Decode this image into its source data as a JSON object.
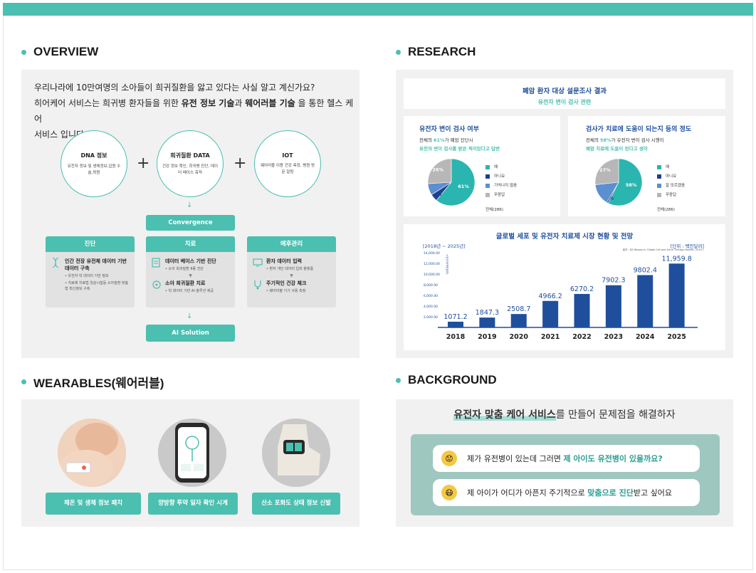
{
  "sections": {
    "overview": "OVERVIEW",
    "research": "RESEARCH",
    "wearables": "WEARABLES(웨어러블)",
    "background": "BACKGROUND"
  },
  "overview": {
    "line1": "우리나라에 10만여명의 소아들이 희귀질환을 앓고 있다는 사실 알고 계신가요?",
    "line2_a": "히어케어 서비스는 희귀병 환자들을 위한 ",
    "line2_b": "유전 정보 기술",
    "line2_c": "과 ",
    "line2_d": "웨어러블 기술",
    "line2_e": " 을 통한 헬스 케어",
    "line3": "서비스 입니다 .",
    "circles": [
      {
        "title": "DNA 정보",
        "desc": "유전자 정보 및 생체정보,입원 수술,퇴원"
      },
      {
        "title": "희귀질환 DATA",
        "desc": "건강 정보 확인, 희귀병 진단, 데이터 베이스 축적"
      },
      {
        "title": "IOT",
        "desc": "웨어러블 이용 건강 측정, 병원 방문 알림"
      }
    ],
    "plus": "+",
    "arrow": "↓",
    "convergence": "Convergence",
    "ai": "AI Solution",
    "cards": [
      {
        "header": "진단",
        "items": [
          {
            "icon": "dna-icon",
            "title": "인간 전장 유전체 데이터 기반 데이터 구축",
            "desc1": "• 유전자 빅 데이터 기반 정보",
            "desc2": "• 치료제 치료법 임상시험등 소아질환 맞춤형 최신정보 구축"
          }
        ]
      },
      {
        "header": "치료",
        "items": [
          {
            "icon": "document-icon",
            "title": "데이터 베이스 기반 진단",
            "desc1": "• 소아 희귀질환 8종 진단",
            "desc2": ""
          },
          {
            "icon": "ai-brain-icon",
            "title": "소아 희귀질환 치료",
            "desc1": "• 빅 데이터 기반 AI 솔루션 제공",
            "desc2": ""
          }
        ]
      },
      {
        "header": "예후관리",
        "items": [
          {
            "icon": "monitor-icon",
            "title": "환자 데이터 입력",
            "desc1": "• 환자 개인 데이터 입력 플랫폼",
            "desc2": ""
          },
          {
            "icon": "stethoscope-icon",
            "title": "주기적인 건강 체크",
            "desc1": "• 웨어러블 기기 사용 측정",
            "desc2": ""
          }
        ]
      }
    ],
    "mini_arrow": "▼"
  },
  "research": {
    "survey_title": "폐암 환자 대상 설문조사 결과",
    "survey_sub": "유전자 변이 검사 관련",
    "pie1": {
      "title": "유전자 변이 검사 여부",
      "sub1_a": "전체의 ",
      "sub1_b": "61%",
      "sub1_c": "가 폐암 진단시",
      "sub2": "유전자 변이 검사를 받은 적이있다고 답변",
      "footer": "전체(286)"
    },
    "pie2": {
      "title": "검사가 치료에 도움이 되는지 등의 정도",
      "sub1_a": "전체의 ",
      "sub1_b": "58%",
      "sub1_c": "가 유전자 변이 검사 시행이",
      "sub2": "폐암 치료에 도움이 된다고 생각",
      "footer": "전체(286)"
    },
    "bar": {
      "title": "글로벌 세포 및 유전자 치료제 시장 현황 및 전망",
      "period": "[2018년 ~ 2025년]",
      "unit": "[단위 : 백만달러]",
      "source": "출처 : DS Research, Global Cell and Gene Therapy Market, 2019.7",
      "yticks": [
        "14,000.00",
        "12,000.00",
        "10,000.00",
        "8,000.00",
        "6,000.00",
        "4,000.00",
        "2,000.00"
      ],
      "ylabel": "시장규모(백만달러)"
    }
  },
  "chart_data": [
    {
      "type": "pie",
      "title": "유전자 변이 검사 여부",
      "categories": [
        "예",
        "아니요",
        "기억나지 않음",
        "무응답"
      ],
      "values": [
        61,
        5,
        8,
        26
      ],
      "colors": [
        "#2bb5b0",
        "#1f3f8f",
        "#5b8fd0",
        "#b7b7b7"
      ]
    },
    {
      "type": "pie",
      "title": "검사가 치료에 도움이 되는지 등의 정도",
      "categories": [
        "예",
        "아니요",
        "잘 모르겠음",
        "무응답"
      ],
      "values": [
        58,
        1,
        15,
        27
      ],
      "colors": [
        "#2bb5b0",
        "#1f3f8f",
        "#5b8fd0",
        "#b7b7b7"
      ]
    },
    {
      "type": "bar",
      "title": "글로벌 세포 및 유전자 치료제 시장 현황 및 전망",
      "categories": [
        "2018",
        "2019",
        "2020",
        "2021",
        "2022",
        "2023",
        "2024",
        "2025"
      ],
      "values": [
        1071.2,
        1847.3,
        2508.7,
        4966.2,
        6270.2,
        7902.3,
        9802.4,
        11959.8
      ],
      "labels": [
        "1071.2",
        "1847.3",
        "2508.7",
        "4966.2",
        "6270.2",
        "7902.3",
        "9802.4",
        "11,959.8"
      ],
      "ylim": [
        0,
        14000
      ],
      "color": "#1f4e9c"
    }
  ],
  "wearables": [
    {
      "label": "체온 및 생체 정보 패치",
      "image": "baby-patch-image"
    },
    {
      "label": "양방향 투약 일자 확인 시계",
      "image": "smartwatch-image"
    },
    {
      "label": "산소 포화도 상태 정보 신발",
      "image": "smart-shoe-image"
    }
  ],
  "background": {
    "title_b": "유전자 맞춤 케어 서비스",
    "title_rest": "를 만들어 문제점을 해결하자",
    "q1_a": "제가 유전병이 있는데 그러면 ",
    "q1_b": "제 아이도 유전병이 있을까요?",
    "q2_a": "제 아이가 어디가 아픈지 주기적으로 ",
    "q2_b": "맞춤으로 진단",
    "q2_c": "받고 싶어요",
    "emoji1": "😟",
    "emoji2": "😷"
  }
}
